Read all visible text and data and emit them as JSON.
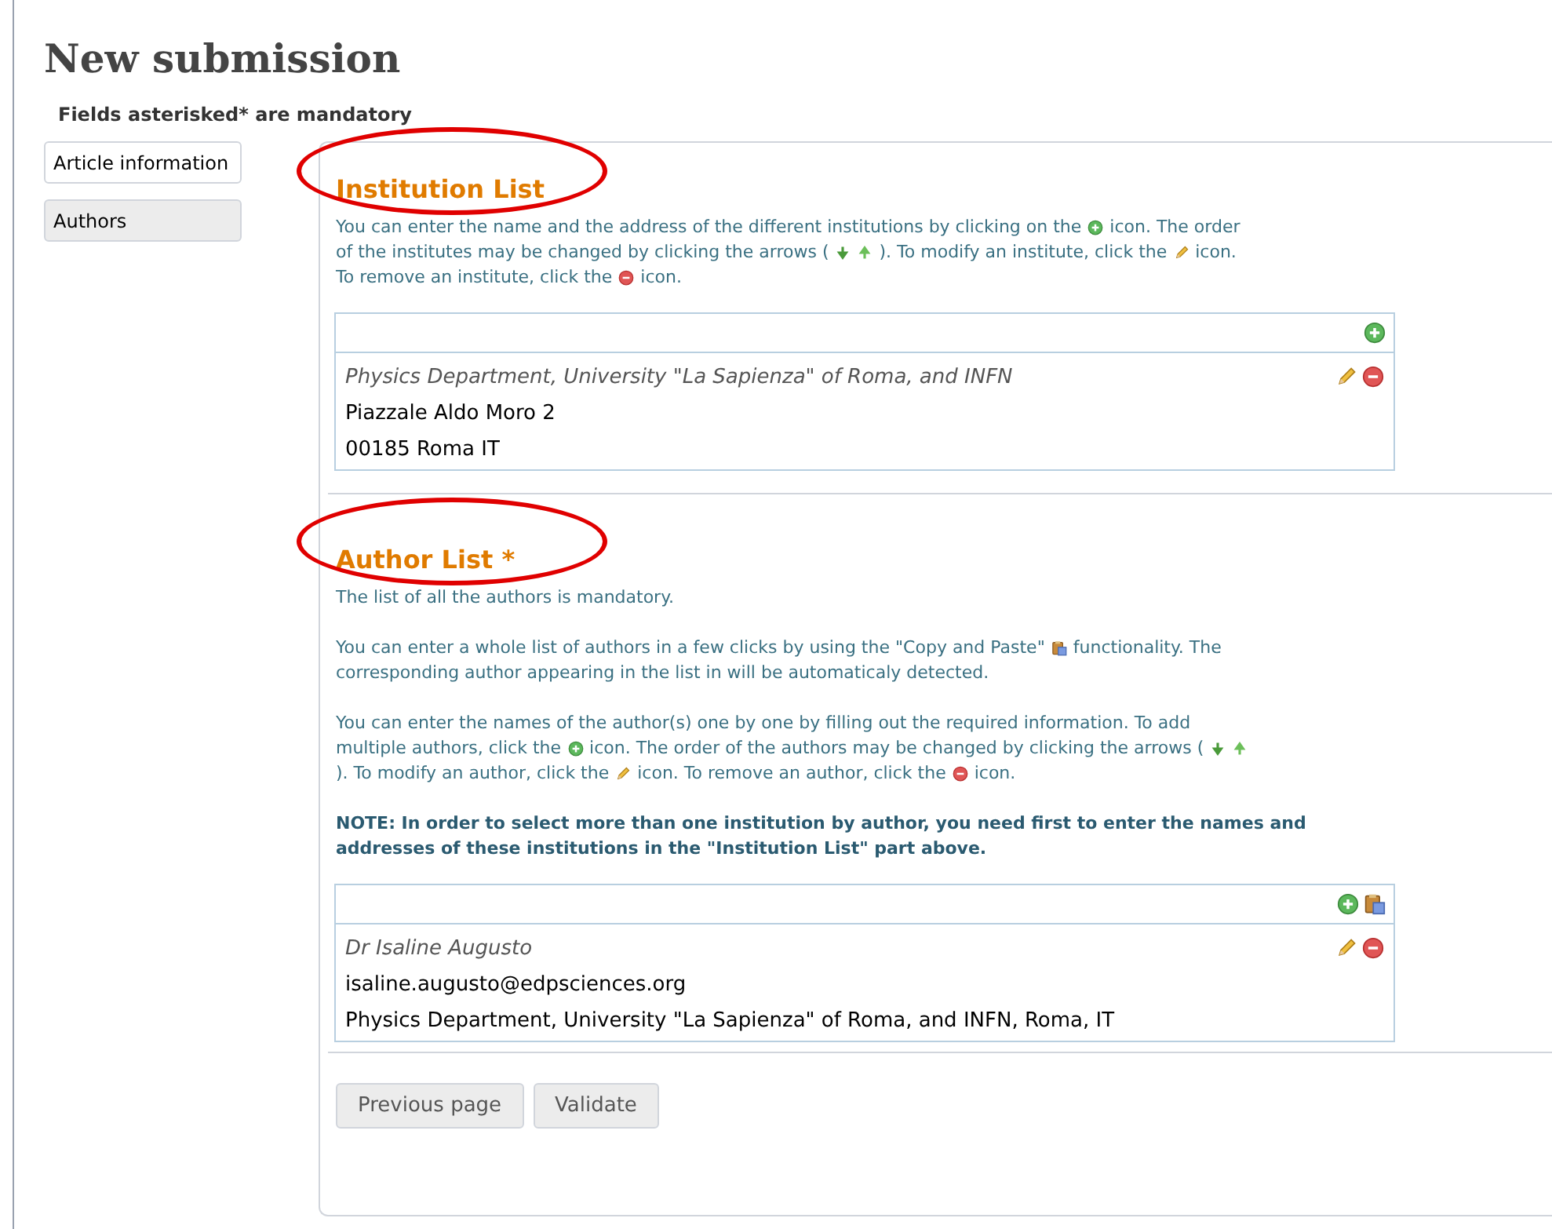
{
  "page_title": "New submission",
  "mandatory_note": "Fields asterisked* are mandatory",
  "nav": [
    {
      "label": "Article information",
      "selected": false
    },
    {
      "label": "Authors",
      "selected": true
    }
  ],
  "sections": [
    {
      "heading": "Institution List",
      "circled": true,
      "paragraphs": [
        {
          "kind": "plain",
          "lines": [
            [
              {
                "kind": "text",
                "text": "You can enter the name and the address of the different institutions by clicking on the"
              },
              {
                "kind": "plus"
              },
              {
                "kind": "text",
                "text": "icon. The order"
              }
            ],
            [
              {
                "kind": "text",
                "text": "of the institutes may be changed by clicking the arrows ("
              },
              {
                "kind": "arrow_down"
              },
              {
                "kind": "arrow_up"
              },
              {
                "kind": "text",
                "text": "). To modify an institute, click the"
              },
              {
                "kind": "pencil"
              },
              {
                "kind": "text",
                "text": "icon."
              }
            ],
            [
              {
                "kind": "text",
                "text": "To remove an institute, click the"
              },
              {
                "kind": "minus"
              },
              {
                "kind": "text",
                "text": "icon."
              }
            ]
          ]
        }
      ],
      "list": {
        "toolbar": [
          {
            "kind": "plus"
          }
        ],
        "entries": [
          {
            "title": "Physics Department, University \"La Sapienza\" of Roma, and INFN",
            "lines": [
              "Piazzale Aldo Moro 2",
              "00185 Roma IT"
            ],
            "actions": [
              {
                "kind": "pencil"
              },
              {
                "kind": "minus"
              }
            ]
          }
        ]
      }
    },
    {
      "heading": "Author List *",
      "circled": true,
      "paragraphs": [
        {
          "kind": "plain",
          "lines": [
            [
              {
                "kind": "text",
                "text": "The list of all the authors is mandatory."
              }
            ]
          ]
        },
        {
          "kind": "plain",
          "lines": [
            [
              {
                "kind": "text",
                "text": "You can enter a whole list of authors in a few clicks by using the \"Copy and Paste\""
              },
              {
                "kind": "clipboard"
              },
              {
                "kind": "text",
                "text": "functionality. The"
              }
            ],
            [
              {
                "kind": "text",
                "text": "corresponding author appearing in the list in will be automaticaly detected."
              }
            ]
          ]
        },
        {
          "kind": "plain",
          "lines": [
            [
              {
                "kind": "text",
                "text": "You can enter the names of the author(s) one by one by filling out the required information. To add"
              }
            ],
            [
              {
                "kind": "text",
                "text": "multiple authors, click the"
              },
              {
                "kind": "plus"
              },
              {
                "kind": "text",
                "text": "icon. The order of the authors may be changed by clicking the arrows ("
              },
              {
                "kind": "arrow_down"
              },
              {
                "kind": "arrow_up"
              }
            ],
            [
              {
                "kind": "text",
                "text": "). To modify an author, click the"
              },
              {
                "kind": "pencil"
              },
              {
                "kind": "text",
                "text": "icon. To remove an author, click the"
              },
              {
                "kind": "minus"
              },
              {
                "kind": "text",
                "text": "icon."
              }
            ]
          ]
        },
        {
          "kind": "note",
          "lines": [
            [
              {
                "kind": "text",
                "text": "NOTE: In order to select more than one institution by author, you need first to enter the names and addresses of these institutions in the \"Institution List\" part above."
              }
            ]
          ]
        }
      ],
      "list": {
        "toolbar": [
          {
            "kind": "plus"
          },
          {
            "kind": "clipboard"
          }
        ],
        "entries": [
          {
            "title": "Dr Isaline Augusto",
            "lines": [
              "isaline.augusto@edpsciences.org",
              "Physics Department, University \"La Sapienza\" of Roma, and INFN, Roma, IT"
            ],
            "actions": [
              {
                "kind": "pencil"
              },
              {
                "kind": "minus"
              }
            ]
          }
        ]
      }
    }
  ],
  "buttons": [
    "Previous page",
    "Validate"
  ]
}
